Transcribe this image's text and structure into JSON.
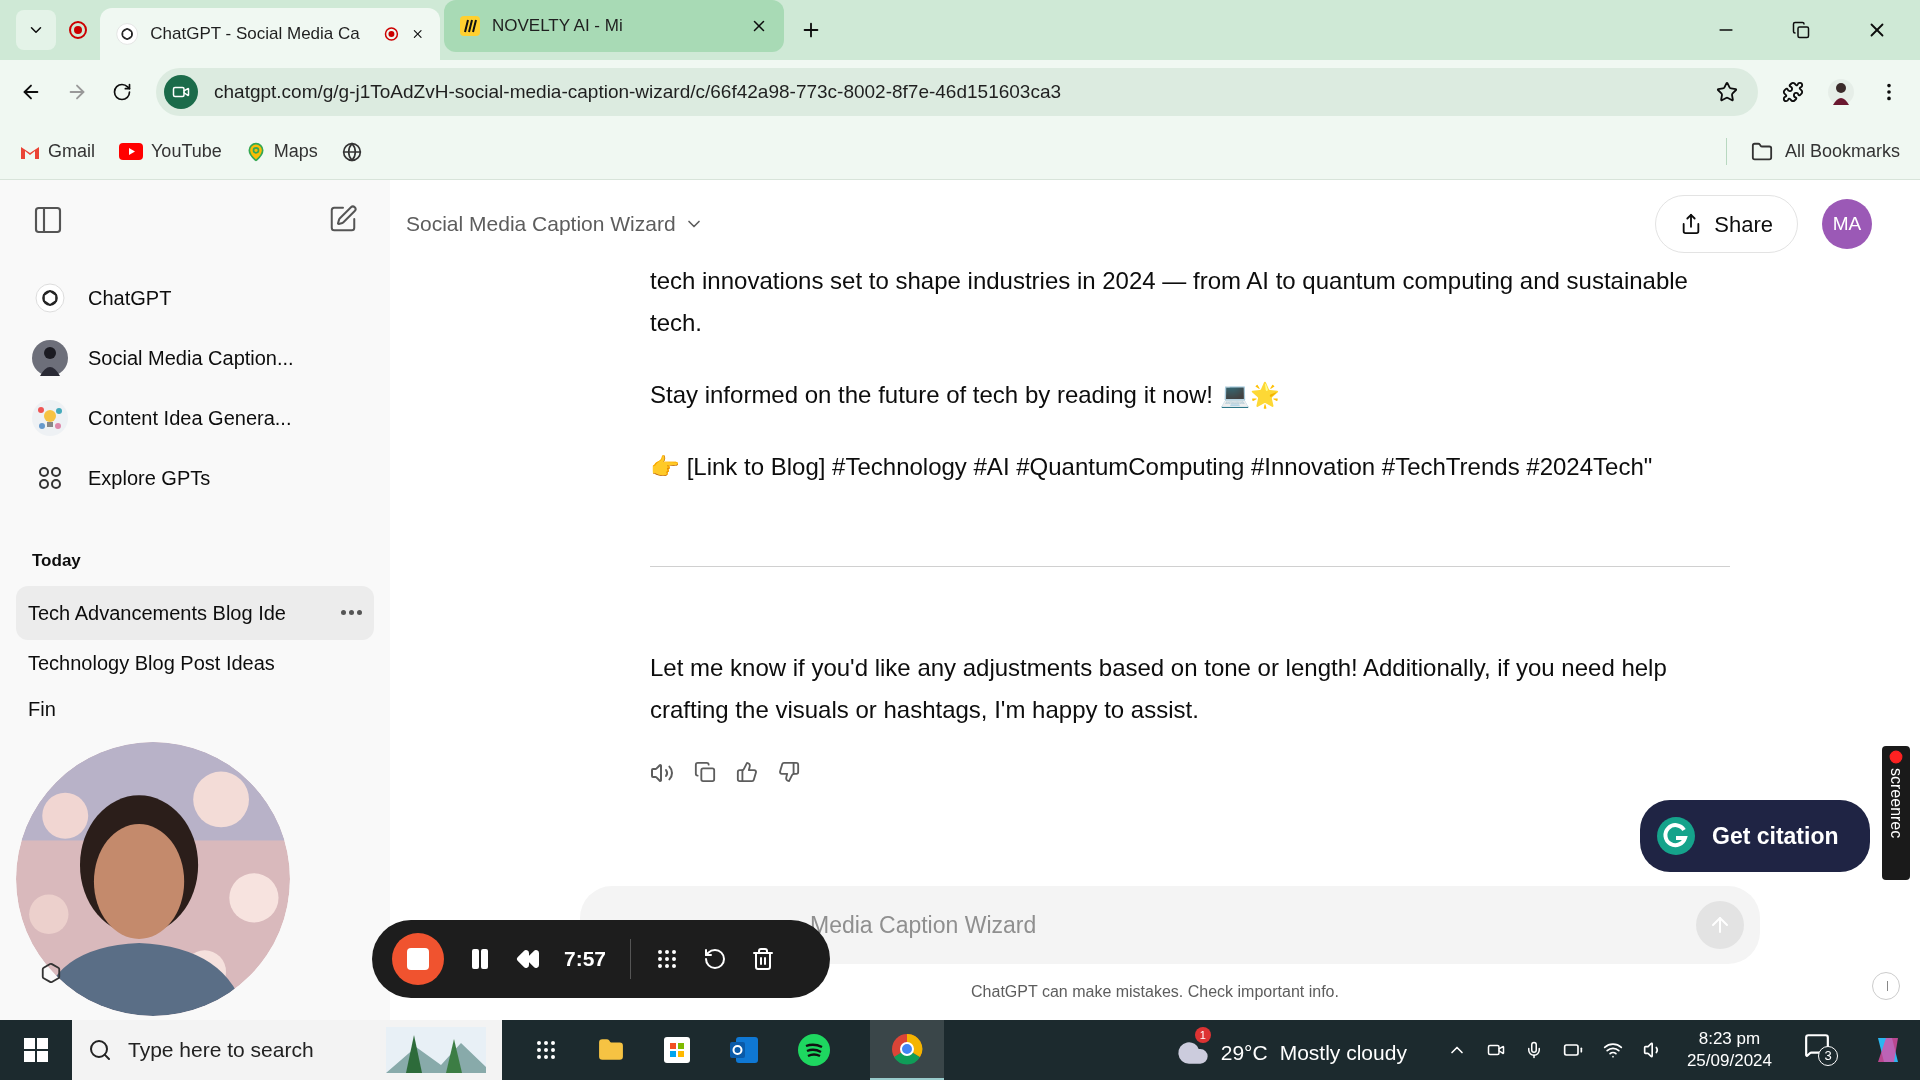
{
  "browser": {
    "tabs": [
      {
        "title": "ChatGPT - Social Media Ca",
        "selected": true,
        "recording": true
      },
      {
        "title": "NOVELTY AI - Mi",
        "selected": false,
        "recording": false
      }
    ],
    "address": "chatgpt.com/g/g-j1ToAdZvH-social-media-caption-wizard/c/66f42a98-773c-8002-8f7e-46d151603ca3",
    "bookmarks": [
      {
        "label": "Gmail",
        "kind": "gmail"
      },
      {
        "label": "YouTube",
        "kind": "youtube"
      },
      {
        "label": "Maps",
        "kind": "maps"
      },
      {
        "kind": "globe"
      }
    ],
    "all_bookmarks": "All Bookmarks"
  },
  "sidebar": {
    "items": [
      {
        "label": "ChatGPT",
        "kind": "chatgpt"
      },
      {
        "label": "Social Media Caption...",
        "kind": "gpt"
      },
      {
        "label": "Content Idea Genera...",
        "kind": "idea"
      },
      {
        "label": "Explore GPTs",
        "kind": "explore"
      }
    ],
    "section": "Today",
    "history": [
      {
        "title": "Tech Advancements Blog Ide",
        "selected": true
      },
      {
        "title": "Technology Blog Post Ideas",
        "selected": false
      },
      {
        "title": "Fin",
        "selected": false
      }
    ]
  },
  "header": {
    "title": "Social Media Caption Wizard",
    "share": "Share",
    "avatar": "MA"
  },
  "message": {
    "paragraphs": [
      "tech innovations set to shape industries in 2024 — from AI to quantum computing and sustainable tech.",
      "Stay informed on the future of tech by reading it now! 💻🌟",
      "👉 [Link to Blog] #Technology #AI #QuantumComputing #Innovation #TechTrends #2024Tech\""
    ],
    "closing": "Let me know if you'd like any adjustments based on tone or length! Additionally, if you need help crafting the visuals or hashtags, I'm happy to assist."
  },
  "composer": {
    "placeholder": "Media Caption Wizard",
    "disclaimer": "ChatGPT can make mistakes. Check important info."
  },
  "recorder": {
    "time": "7:57"
  },
  "citation": "Get citation",
  "screenrec": "screenrec",
  "taskbar": {
    "search_placeholder": "Type here to search",
    "temperature": "29°C",
    "condition": "Mostly cloudy",
    "weather_badge": "1",
    "time": "8:23 pm",
    "date": "25/09/2024",
    "notifications": "3"
  }
}
